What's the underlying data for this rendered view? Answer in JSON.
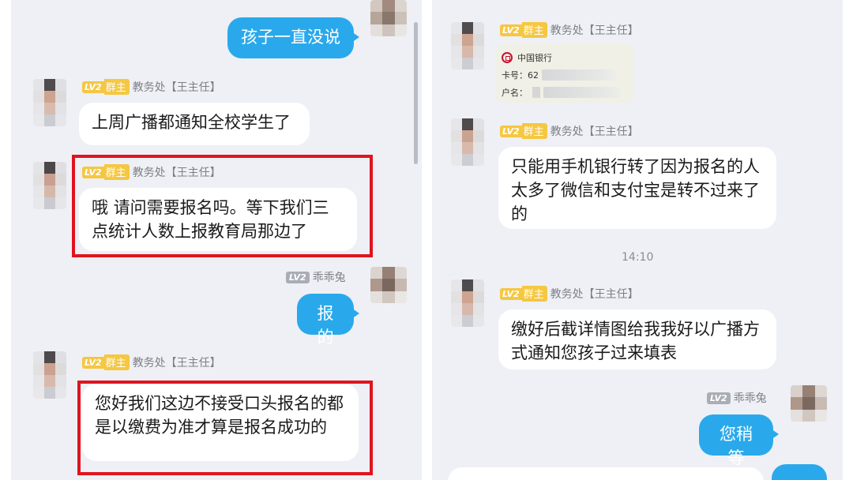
{
  "left": {
    "messages": [
      {
        "kind": "outgoing",
        "text": "孩子一直没说"
      },
      {
        "kind": "incoming",
        "lv": "LV2",
        "role": "群主",
        "sender": "教务处【王主任】",
        "text": "上周广播都通知全校学生了"
      },
      {
        "kind": "incoming",
        "lv": "LV2",
        "role": "群主",
        "sender": "教务处【王主任】",
        "text": "哦 请问需要报名吗。等下我们三点统计人数上报教育局那边了",
        "highlighted": true
      },
      {
        "kind": "outgoing",
        "lv": "LV2",
        "sender": "乖乖兔",
        "text": "报的"
      },
      {
        "kind": "incoming",
        "lv": "LV2",
        "role": "群主",
        "sender": "教务处【王主任】",
        "text": "您好我们这边不接受口头报名的都是以缴费为准才算是报名成功的",
        "highlighted": true
      }
    ]
  },
  "right": {
    "messages": [
      {
        "kind": "incoming-card",
        "lv": "LV2",
        "role": "群主",
        "sender": "教务处【王主任】",
        "bank": "中国银行",
        "card_label": "卡号：",
        "card_prefix": "62",
        "name_label": "户名："
      },
      {
        "kind": "incoming",
        "lv": "LV2",
        "role": "群主",
        "sender": "教务处【王主任】",
        "text": "只能用手机银行转了因为报名的人太多了微信和支付宝是转不过来了的"
      },
      {
        "kind": "time",
        "text": "14:10"
      },
      {
        "kind": "incoming",
        "lv": "LV2",
        "role": "群主",
        "sender": "教务处【王主任】",
        "text": "缴好后截详情图给我我好以广播方式通知您孩子过来填表"
      },
      {
        "kind": "outgoing",
        "lv": "LV2",
        "sender": "乖乖兔",
        "text": "您稍等"
      }
    ]
  },
  "colors": {
    "panel_bg": "#eef0f5",
    "outgoing_bubble": "#29a9ec",
    "incoming_bubble": "#ffffff",
    "role_badge": "#f5c742",
    "highlight_box": "#e0141e"
  }
}
